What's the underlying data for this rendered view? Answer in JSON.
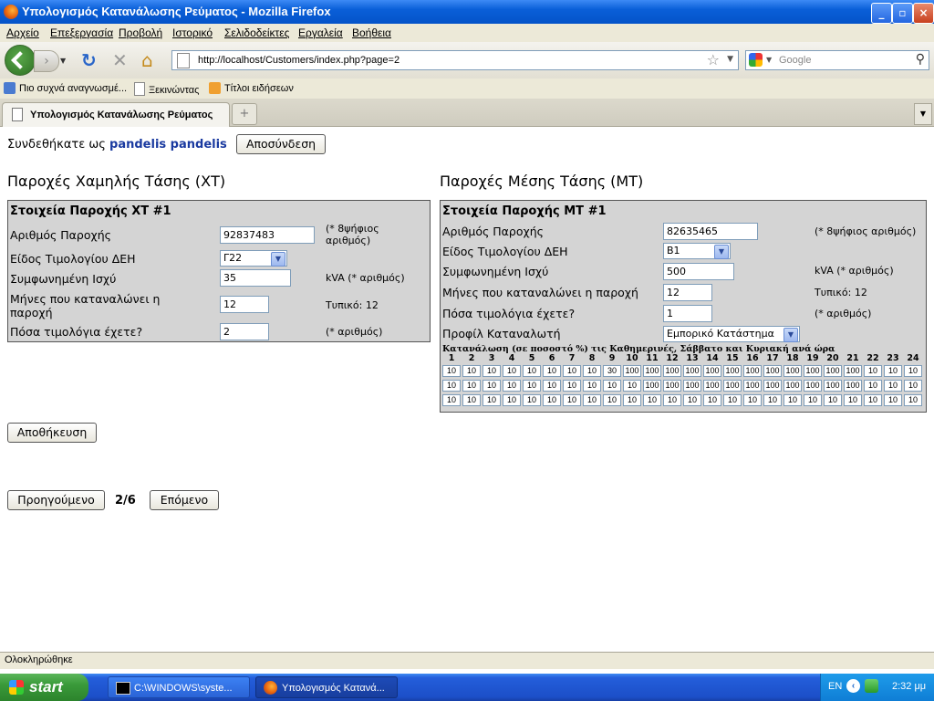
{
  "window": {
    "title": "Υπολογισμός Κατανάλωσης Ρεύματος - Mozilla Firefox",
    "min": "_",
    "max": "▫",
    "close": "×"
  },
  "menu": [
    "Αρχείο",
    "Επεξεργασία",
    "Προβολή",
    "Ιστορικό",
    "Σελιδοδείκτες",
    "Εργαλεία",
    "Βοήθεια"
  ],
  "nav": {
    "url": "http://localhost/Customers/index.php?page=2",
    "search_placeholder": "Google"
  },
  "bookmarks": [
    "Πιο συχνά αναγνωσμέ...",
    "Ξεκινώντας",
    "Τίτλοι ειδήσεων"
  ],
  "tab": {
    "title": "Υπολογισμός Κατανάλωσης Ρεύματος",
    "new_tab": "+"
  },
  "session": {
    "logged_in_as": "Συνδεθήκατε ως",
    "username": "pandelis pandelis",
    "logout": "Αποσύνδεση"
  },
  "lv": {
    "heading": "Παροχές Χαμηλής Τάσης (ΧΤ)",
    "panel_title": "Στοιχεία Παροχής ΧΤ #1",
    "fields": {
      "supply_number": {
        "label": "Αριθμός Παροχής",
        "value": "92837483",
        "note": "(* 8ψήφιος αριθμός)"
      },
      "tariff": {
        "label": "Είδος Τιμολογίου ΔΕΗ",
        "value": "Γ22"
      },
      "power": {
        "label": "Συμφωνημένη Ισχύ",
        "value": "35",
        "note": "kVA (* αριθμός)"
      },
      "months": {
        "label": "Μήνες που καταναλώνει η παροχή",
        "value": "12",
        "note": "Τυπικό: 12"
      },
      "invoices": {
        "label": "Πόσα τιμολόγια έχετε?",
        "value": "2",
        "note": "(* αριθμός)"
      }
    }
  },
  "mv": {
    "heading": "Παροχές Μέσης Τάσης (ΜΤ)",
    "panel_title": "Στοιχεία Παροχής ΜΤ #1",
    "fields": {
      "supply_number": {
        "label": "Αριθμός Παροχής",
        "value": "82635465",
        "note": "(* 8ψήφιος αριθμός)"
      },
      "tariff": {
        "label": "Είδος Τιμολογίου ΔΕΗ",
        "value": "Β1"
      },
      "power": {
        "label": "Συμφωνημένη Ισχύ",
        "value": "500",
        "note": "kVA (* αριθμός)"
      },
      "months": {
        "label": "Μήνες που καταναλώνει η παροχή",
        "value": "12",
        "note": "Τυπικό: 12"
      },
      "invoices": {
        "label": "Πόσα τιμολόγια έχετε?",
        "value": "1",
        "note": "(* αριθμός)"
      },
      "profile": {
        "label": "Προφίλ Καταναλωτή",
        "value": "Εμπορικό Κατάστημα"
      }
    },
    "consumption_caption": "Κατανάλωση (σε ποσοστό %) τις Καθημερινές, Σάββατο και Κυριακή ανά ώρα",
    "hours": [
      "1",
      "2",
      "3",
      "4",
      "5",
      "6",
      "7",
      "8",
      "9",
      "10",
      "11",
      "12",
      "13",
      "14",
      "15",
      "16",
      "17",
      "18",
      "19",
      "20",
      "21",
      "22",
      "23",
      "24"
    ],
    "rows": [
      [
        "10",
        "10",
        "10",
        "10",
        "10",
        "10",
        "10",
        "10",
        "30",
        "100",
        "100",
        "100",
        "100",
        "100",
        "100",
        "100",
        "100",
        "100",
        "100",
        "100",
        "100",
        "10",
        "10",
        "10"
      ],
      [
        "10",
        "10",
        "10",
        "10",
        "10",
        "10",
        "10",
        "10",
        "10",
        "10",
        "100",
        "100",
        "100",
        "100",
        "100",
        "100",
        "100",
        "100",
        "100",
        "100",
        "100",
        "10",
        "10",
        "10"
      ],
      [
        "10",
        "10",
        "10",
        "10",
        "10",
        "10",
        "10",
        "10",
        "10",
        "10",
        "10",
        "10",
        "10",
        "10",
        "10",
        "10",
        "10",
        "10",
        "10",
        "10",
        "10",
        "10",
        "10",
        "10"
      ]
    ]
  },
  "actions": {
    "save": "Αποθήκευση",
    "prev": "Προηγούμενο",
    "page": "2/6",
    "next": "Επόμενο"
  },
  "status": "Ολοκληρώθηκε",
  "taskbar": {
    "start": "start",
    "tasks": [
      "C:\\WINDOWS\\syste...",
      "Υπολογισμός Κατανά..."
    ],
    "lang": "EN",
    "time": "2:32 μμ"
  }
}
